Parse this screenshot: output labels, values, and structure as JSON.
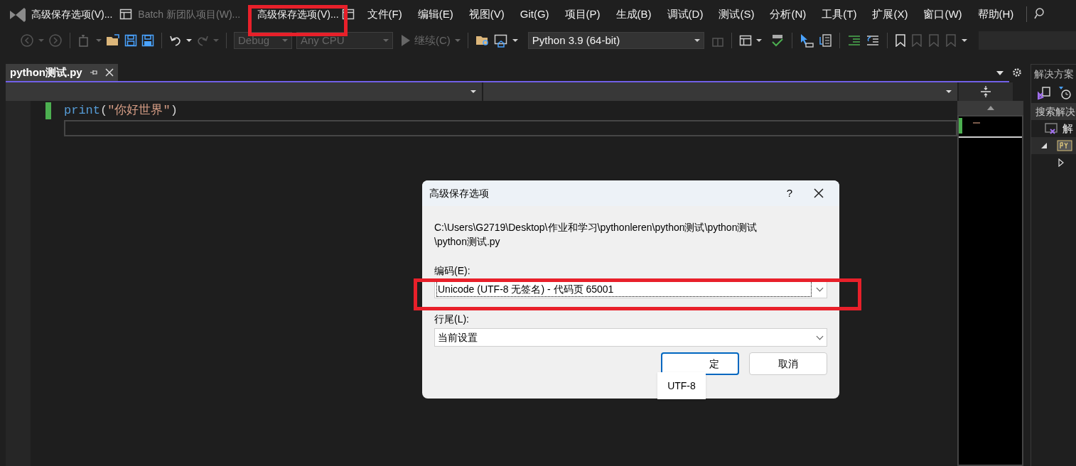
{
  "title_bar": {
    "items": [
      {
        "text": "高级保存选项(V)...",
        "disabled": false
      },
      {
        "text": "Batch 新团队项目(W)...",
        "disabled": true
      },
      {
        "text": "高级保存选项(V)...",
        "disabled": false
      }
    ]
  },
  "menu": [
    "文件(F)",
    "编辑(E)",
    "视图(V)",
    "Git(G)",
    "项目(P)",
    "生成(B)",
    "调试(D)",
    "测试(S)",
    "分析(N)",
    "工具(T)",
    "扩展(X)",
    "窗口(W)",
    "帮助(H)"
  ],
  "toolbar": {
    "configuration": {
      "value": "Debug",
      "disabled": true
    },
    "platform": {
      "value": "Any CPU",
      "disabled": true
    },
    "continue": {
      "label": "继续(C)",
      "disabled": true
    },
    "environment": {
      "value": "Python 3.9 (64-bit)",
      "disabled": false
    }
  },
  "tabs": [
    {
      "label": "python测试.py",
      "selected": true
    }
  ],
  "editor": {
    "lines": [
      {
        "modified": true,
        "tokens": [
          {
            "kind": "function",
            "text": "print"
          },
          {
            "kind": "punct",
            "text": "("
          },
          {
            "kind": "string",
            "text": "\"你好世界\""
          },
          {
            "kind": "punct",
            "text": ")"
          }
        ]
      },
      {
        "modified": false
      }
    ]
  },
  "solution_explorer": {
    "title": "解决方案",
    "search": {
      "placeholder": "搜索解决"
    },
    "items": [
      {
        "label": "解",
        "children": [
          {
            "kind": "py",
            "expanded": true
          }
        ]
      }
    ]
  },
  "dialog": {
    "title": "高级保存选项",
    "help": "?",
    "path": "C:\\Users\\G2719\\Desktop\\作业和学习\\pythonleren\\python测试\\python测试\n\\python测试.py",
    "fields": [
      {
        "label": "编码(E):",
        "value": "Unicode (UTF-8 无签名) - 代码页 65001",
        "focused": true
      },
      {
        "label": "行尾(L):",
        "value": "当前设置",
        "focused": false
      }
    ],
    "buttons": [
      {
        "label": "定",
        "default": true
      },
      {
        "label": "取消",
        "default": false
      }
    ],
    "tooltip": "UTF-8"
  }
}
